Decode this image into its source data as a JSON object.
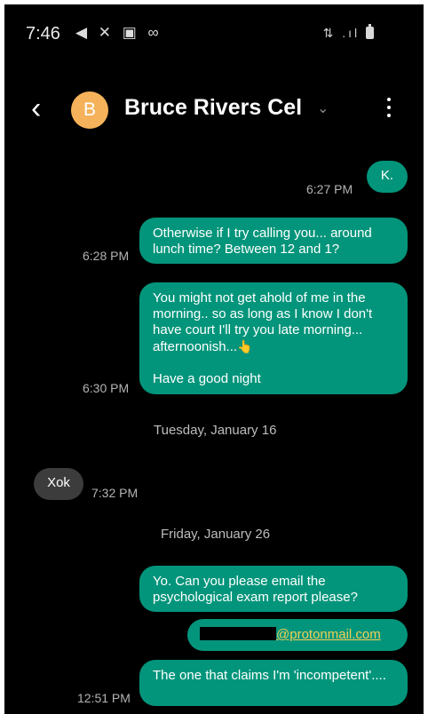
{
  "status_bar": {
    "time": "7:46",
    "left_icons": "◀ ✕ ▣ ∞",
    "right_icons": "⇅ .ıl"
  },
  "header": {
    "avatar_letter": "B",
    "contact_name": "Bruce Rivers Cel",
    "chevron": "⌄",
    "back": "‹"
  },
  "messages": [
    {
      "dir": "out",
      "text": "K.",
      "time": "6:27 PM"
    },
    {
      "dir": "out",
      "text": "Otherwise if I try calling you... around lunch time? Between 12 and 1?",
      "time": "6:28 PM"
    },
    {
      "dir": "out",
      "text_1": "You might not get ahold of me in the morning.. so as long as I know I don't have court I'll try you late morning... afternoonish...",
      "emoji": "👆",
      "text_2": "Have a good night",
      "time": "6:30 PM"
    },
    {
      "dir": "out",
      "text": "Yo. Can you please email the psychological exam report please?"
    },
    {
      "dir": "out",
      "text": "@protonmail.com"
    },
    {
      "dir": "out",
      "text": "The one that claims I'm 'incompetent'....",
      "time": "12:51 PM"
    }
  ],
  "incoming": [
    {
      "dir": "in",
      "text": "Xok",
      "time": "7:32 PM"
    }
  ],
  "dates": [
    "Tuesday, January 16",
    "Friday, January 26"
  ],
  "colors": {
    "outgoing": "#03957b",
    "incoming": "#3c3c3c",
    "avatar": "#f5b25a",
    "link": "#f4cf57"
  }
}
